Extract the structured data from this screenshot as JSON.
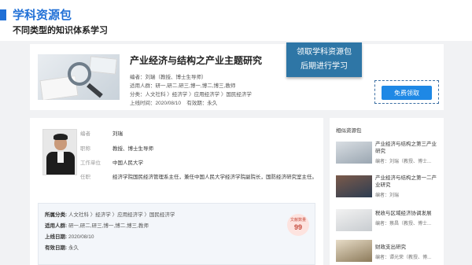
{
  "header": {
    "title": "学科资源包",
    "subtitle": "不同类型的知识体系学习"
  },
  "resource": {
    "name": "产业经济与结构之产业主题研究",
    "editor_label": "编者：",
    "editor": "刘瑞（教授、博士生导师）",
    "audience_label": "适用人群：",
    "audience": "研一,研二,研三,博一,博二,博三,教师",
    "category_label": "分类：",
    "category": "人文社科 〉经济学 〉应用经济学 〉国民经济学",
    "online_label": "上线时间：",
    "online_date": "2020/08/10",
    "valid_label": "有效期：",
    "valid": "永久"
  },
  "callout": {
    "line1": "领取学科资源包",
    "line2": "后期进行学习"
  },
  "free_button": "免费领取",
  "author": {
    "rows": [
      {
        "label": "编者",
        "value": "刘瑞"
      },
      {
        "label": "职称",
        "value": "教授、博士生导师"
      },
      {
        "label": "工作单位",
        "value": "中国人民大学"
      },
      {
        "label": "任职",
        "value": "经济学院国民经济管理系主任，兼任中国人民大学经济学院副院长，国防经济研究室主任。"
      }
    ]
  },
  "meta": {
    "category_label": "所属分类:",
    "category": "人文社科 〉经济学 〉应用经济学 〉国民经济学",
    "audience_label": "适用人群:",
    "audience": "研一,研二,研三,博一,博二,博三,教师",
    "online_label": "上线日期:",
    "online_date": "2020/08/10",
    "valid_label": "有效日期:",
    "valid": "永久",
    "docs_label": "文献数量",
    "docs_count": "99"
  },
  "related": {
    "title": "相似资源包",
    "items": [
      {
        "title": "产业经济与结构之第三产业研究",
        "editor": "编者：刘瑞（教授、博士..."
      },
      {
        "title": "产业经济与结构之第一二产业研究",
        "editor": "编者：刘瑞"
      },
      {
        "title": "税收与区域经济协调发展",
        "editor": "编者：蔡昌（教授、博士..."
      },
      {
        "title": "财政支出研究",
        "editor": "编者：谭光荣（教授、博..."
      }
    ]
  }
}
